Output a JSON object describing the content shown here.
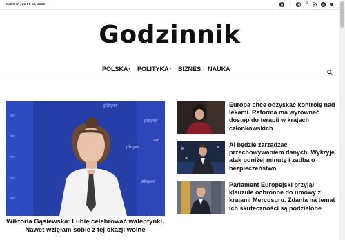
{
  "topbar": {
    "date": "SOBOTA, LUTY 14, 2026",
    "social_icons": [
      "globe-icon",
      "facebook-icon",
      "instagram-icon",
      "pinterest-icon",
      "rss-icon",
      "threads-icon",
      "twitter-icon"
    ]
  },
  "site": {
    "logo": "Godzinnik"
  },
  "nav": {
    "items": [
      {
        "label": "POLSKA",
        "has_dropdown": true
      },
      {
        "label": "POLITYKA",
        "has_dropdown": true
      },
      {
        "label": "BIZNES",
        "has_dropdown": false
      },
      {
        "label": "NAUKA",
        "has_dropdown": false
      }
    ],
    "search_icon": "search-icon"
  },
  "featured": {
    "title": "Wiktoria Gąsiewska: Lubię celebrować walentynki. Nawet wzięłam sobie z tej okazji wolne",
    "backdrop_words": [
      "player",
      "player",
      "player",
      "player",
      "tvn",
      "tvn",
      "tvn",
      "tvn",
      "tvn",
      "tvn"
    ]
  },
  "stories": [
    {
      "title": "Europa chce odzyskać kontrolę nad lekami. Reforma ma wyrównać dostęp do terapii w krajach członkowskich"
    },
    {
      "title": "AI będzie zarządzać przechowywaniem danych. Wykryje atak poniżej minuty i zadba o bezpieczeństwo"
    },
    {
      "title": "Parlament Europejski przyjął klauzule ochronne do umowy z krajami Mercosuru. Zdania na temat ich skuteczności są podzielone"
    }
  ],
  "colors": {
    "backdrop_blue": "#263ea8",
    "text": "#111111",
    "divider": "#e6e6e6"
  }
}
